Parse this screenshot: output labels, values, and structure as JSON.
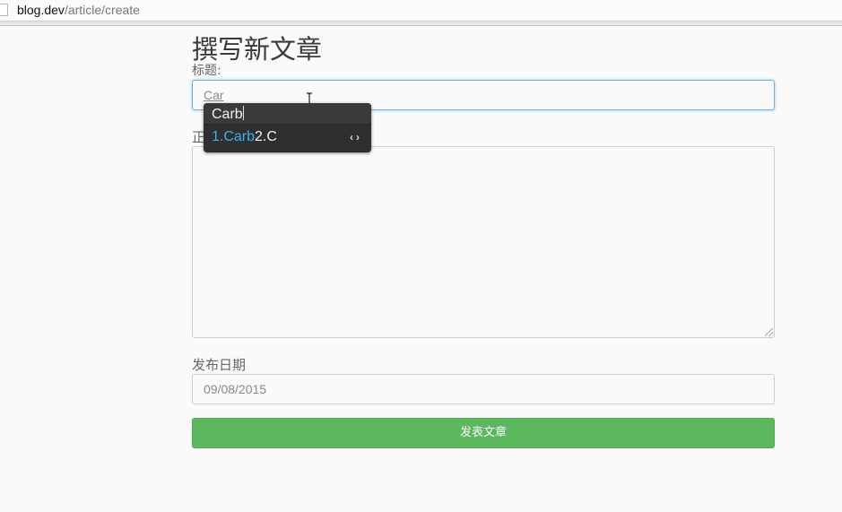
{
  "browser": {
    "url_host": "blog.dev",
    "url_path": "/article/create"
  },
  "page": {
    "title": "撰写新文章"
  },
  "form": {
    "title_label": "标题:",
    "title_value": "Car",
    "body_label": "正",
    "date_label": "发布日期",
    "date_value": "09/08/2015",
    "submit_label": "发表文章"
  },
  "ime": {
    "composition": "Carb",
    "candidate_1": "1.Carb",
    "candidate_2": "2.C",
    "pager": "‹›"
  },
  "colors": {
    "submit_bg": "#5cb85c",
    "focus_border": "#66afe9",
    "candidate_highlight": "#3ab0f0"
  }
}
